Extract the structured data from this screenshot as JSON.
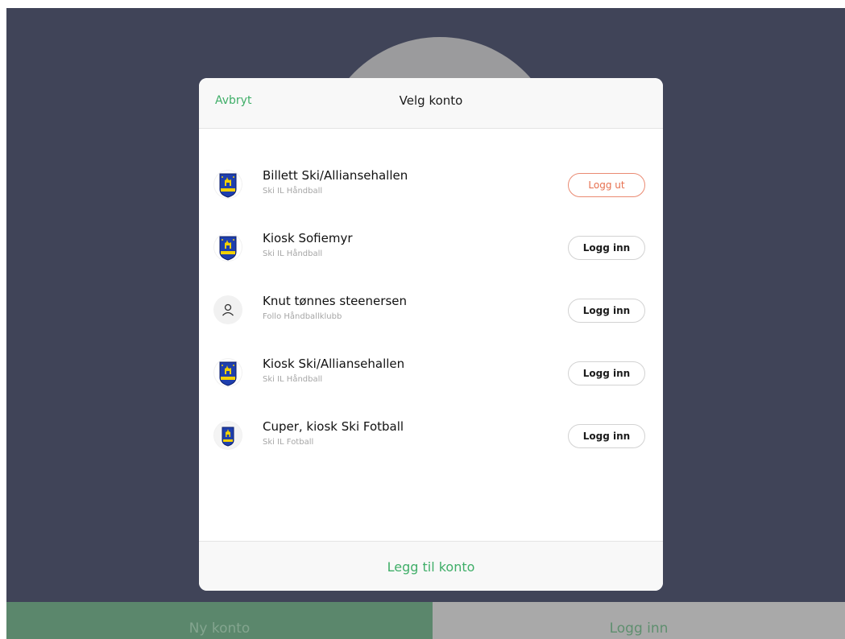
{
  "modal": {
    "cancel_label": "Avbryt",
    "title": "Velg konto",
    "add_account_label": "Legg til konto"
  },
  "accounts": [
    {
      "name": "Billett Ski/Alliansehallen",
      "org": "Ski IL Håndball",
      "action": "Logg ut",
      "avatar": "club-logo-icon"
    },
    {
      "name": "Kiosk Sofiemyr",
      "org": "Ski IL Håndball",
      "action": "Logg inn",
      "avatar": "club-logo-icon"
    },
    {
      "name": "Knut tønnes steenersen",
      "org": "Follo Håndballklubb",
      "action": "Logg inn",
      "avatar": "user-icon"
    },
    {
      "name": "Kiosk Ski/Alliansehallen",
      "org": "Ski IL Håndball",
      "action": "Logg inn",
      "avatar": "club-logo-icon"
    },
    {
      "name": "Cuper, kiosk Ski Fotball",
      "org": "Ski IL Fotball",
      "action": "Logg inn",
      "avatar": "club-logo-icon"
    }
  ],
  "bottom_bar": {
    "new_account_label": "Ny konto",
    "login_label": "Logg inn"
  },
  "colors": {
    "accent_green": "#3fae68",
    "logout_red": "#e7704f",
    "background": "#404458",
    "club_blue": "#1e3fae",
    "club_yellow": "#f2d000"
  }
}
